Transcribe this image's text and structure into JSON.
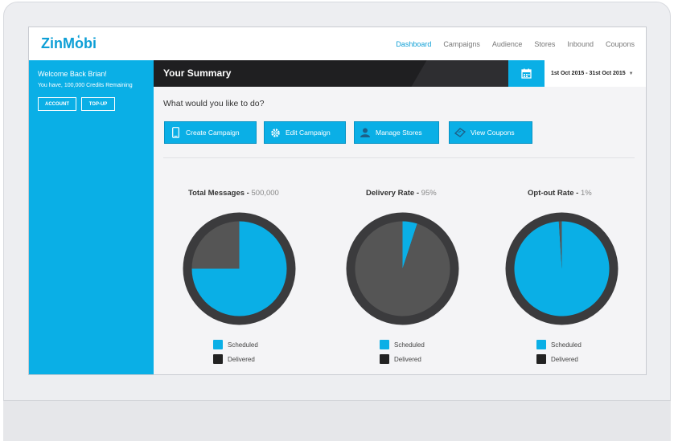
{
  "app": {
    "logo": "ZinMobi"
  },
  "nav": {
    "items": [
      {
        "label": "Dashboard",
        "active": true
      },
      {
        "label": "Campaigns",
        "active": false
      },
      {
        "label": "Audience",
        "active": false
      },
      {
        "label": "Stores",
        "active": false
      },
      {
        "label": "Inbound",
        "active": false
      },
      {
        "label": "Coupons",
        "active": false
      }
    ]
  },
  "sidebar": {
    "welcome": "Welcome Back Brian!",
    "credits": "You have, 100,000 Credits Remaining",
    "account_label": "ACCOUNT",
    "topup_label": "TOP-UP"
  },
  "summary": {
    "title": "Your Summary",
    "date_range": "1st Oct 2015 - 31st Oct 2015",
    "question": "What would you like to do?"
  },
  "actions": [
    {
      "label": "Create Campaign",
      "icon": "phone-icon"
    },
    {
      "label": "Edit Campaign",
      "icon": "gear-icon"
    },
    {
      "label": "Manage Stores",
      "icon": "user-icon"
    },
    {
      "label": "View Coupons",
      "icon": "ticket-icon"
    }
  ],
  "colors": {
    "accent": "#0aafe6",
    "dark": "#555555",
    "header": "#1f1f21"
  },
  "chart_data": [
    {
      "type": "pie",
      "title": "Total Messages",
      "value_text": "500,000",
      "labels": [
        "Scheduled",
        "Delivered"
      ],
      "values": [
        75,
        25
      ]
    },
    {
      "type": "pie",
      "title": "Delivery Rate",
      "value_text": "95%",
      "labels": [
        "Scheduled",
        "Delivered"
      ],
      "values": [
        5,
        95
      ]
    },
    {
      "type": "pie",
      "title": "Opt-out Rate",
      "value_text": "1%",
      "labels": [
        "Scheduled",
        "Delivered"
      ],
      "values": [
        99,
        1
      ]
    }
  ],
  "legend": {
    "scheduled": "Scheduled",
    "delivered": "Delivered"
  }
}
